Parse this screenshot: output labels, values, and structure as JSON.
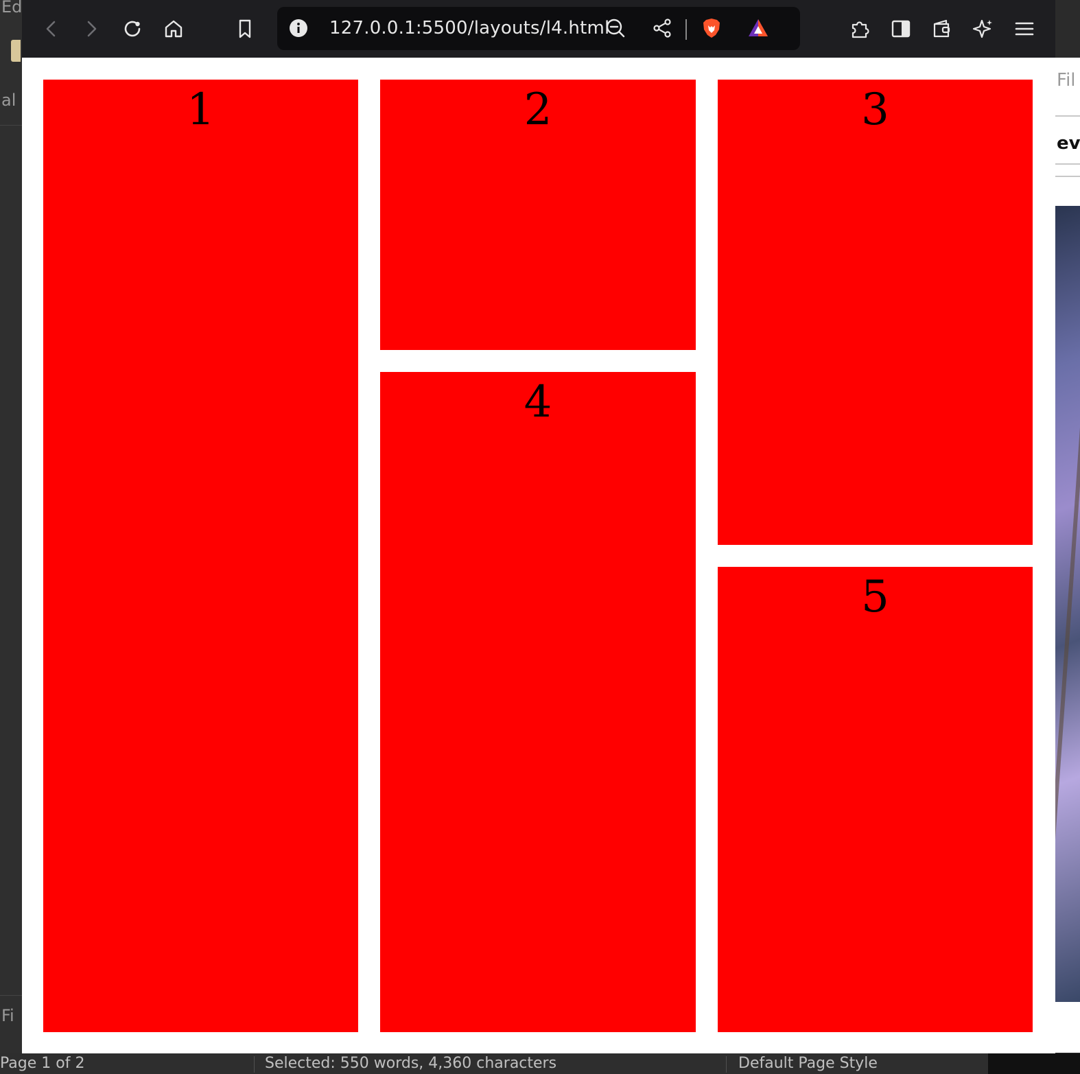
{
  "browser": {
    "url": "127.0.0.1:5500/layouts/l4.html"
  },
  "page": {
    "boxes": [
      "1",
      "2",
      "3",
      "4",
      "5"
    ],
    "box_color": "#ff0000"
  },
  "background_app": {
    "left_fragments": [
      "Ed",
      "al",
      "Fi"
    ],
    "right_fragments": [
      "Fil",
      "evi"
    ],
    "status": {
      "page": "Page 1 of 2",
      "selection": "Selected: 550 words, 4,360 characters",
      "style": "Default Page Style"
    }
  }
}
